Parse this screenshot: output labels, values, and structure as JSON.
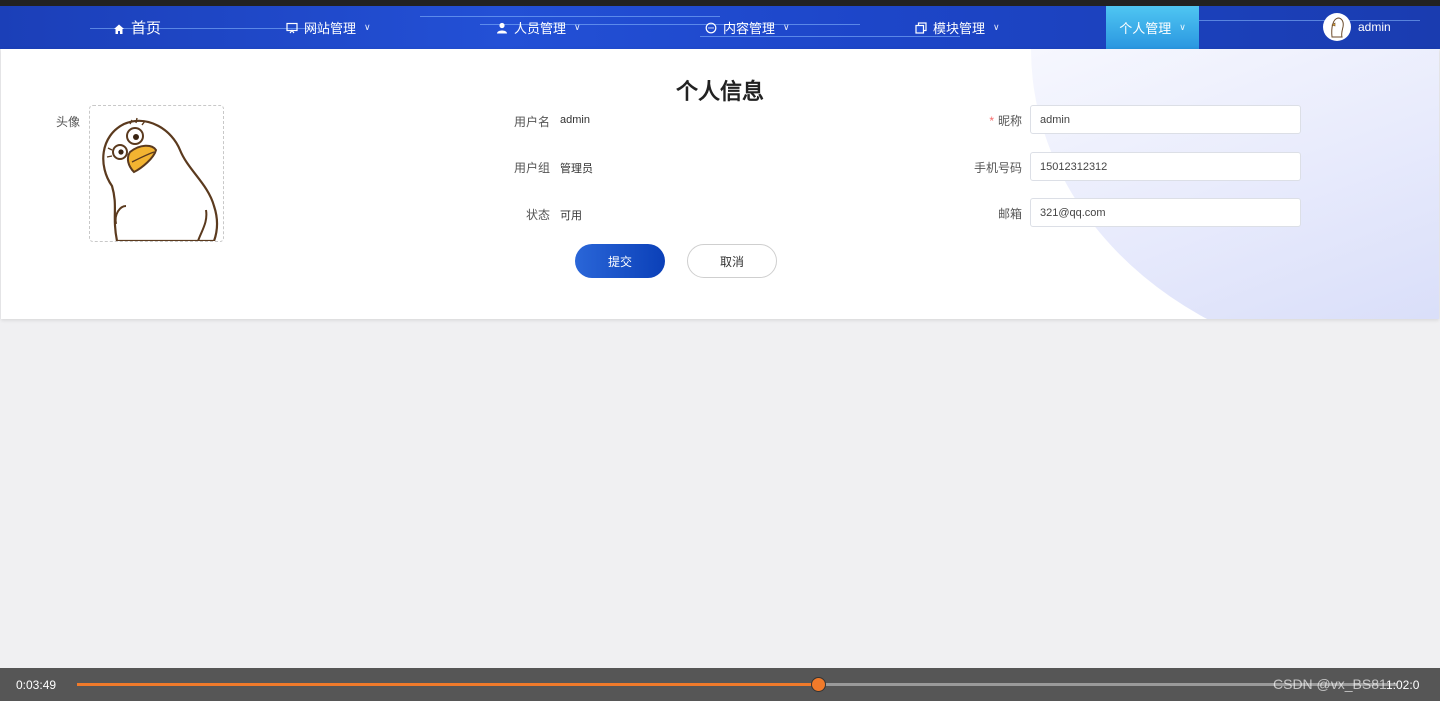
{
  "nav": {
    "items": [
      {
        "label": "首页",
        "icon": "home-icon"
      },
      {
        "label": "网站管理",
        "icon": "monitor-icon",
        "has_dropdown": true
      },
      {
        "label": "人员管理",
        "icon": "user-icon",
        "has_dropdown": true
      },
      {
        "label": "内容管理",
        "icon": "chat-icon",
        "has_dropdown": true
      },
      {
        "label": "模块管理",
        "icon": "copy-icon",
        "has_dropdown": true
      },
      {
        "label": "个人管理",
        "has_dropdown": true,
        "active": true
      }
    ],
    "user": {
      "name": "admin"
    }
  },
  "profile": {
    "title": "个人信息",
    "avatar_label": "头像",
    "fields": {
      "username": {
        "label": "用户名",
        "value": "admin"
      },
      "group": {
        "label": "用户组",
        "value": "管理员"
      },
      "status": {
        "label": "状态",
        "value": "可用"
      },
      "nickname": {
        "label": "昵称",
        "value": "admin",
        "required": true
      },
      "phone": {
        "label": "手机号码",
        "value": "15012312312"
      },
      "email": {
        "label": "邮箱",
        "value": "321@qq.com"
      }
    },
    "submit_label": "提交",
    "cancel_label": "取消"
  },
  "player": {
    "current_time": "0:03:49",
    "total_time": "1:02:0",
    "progress": 0.561,
    "watermark": "CSDN @vx_BS81"
  },
  "colors": {
    "nav": "#2350d6",
    "accent": "#f07a2a",
    "primary_button": "#1a4fc8"
  }
}
